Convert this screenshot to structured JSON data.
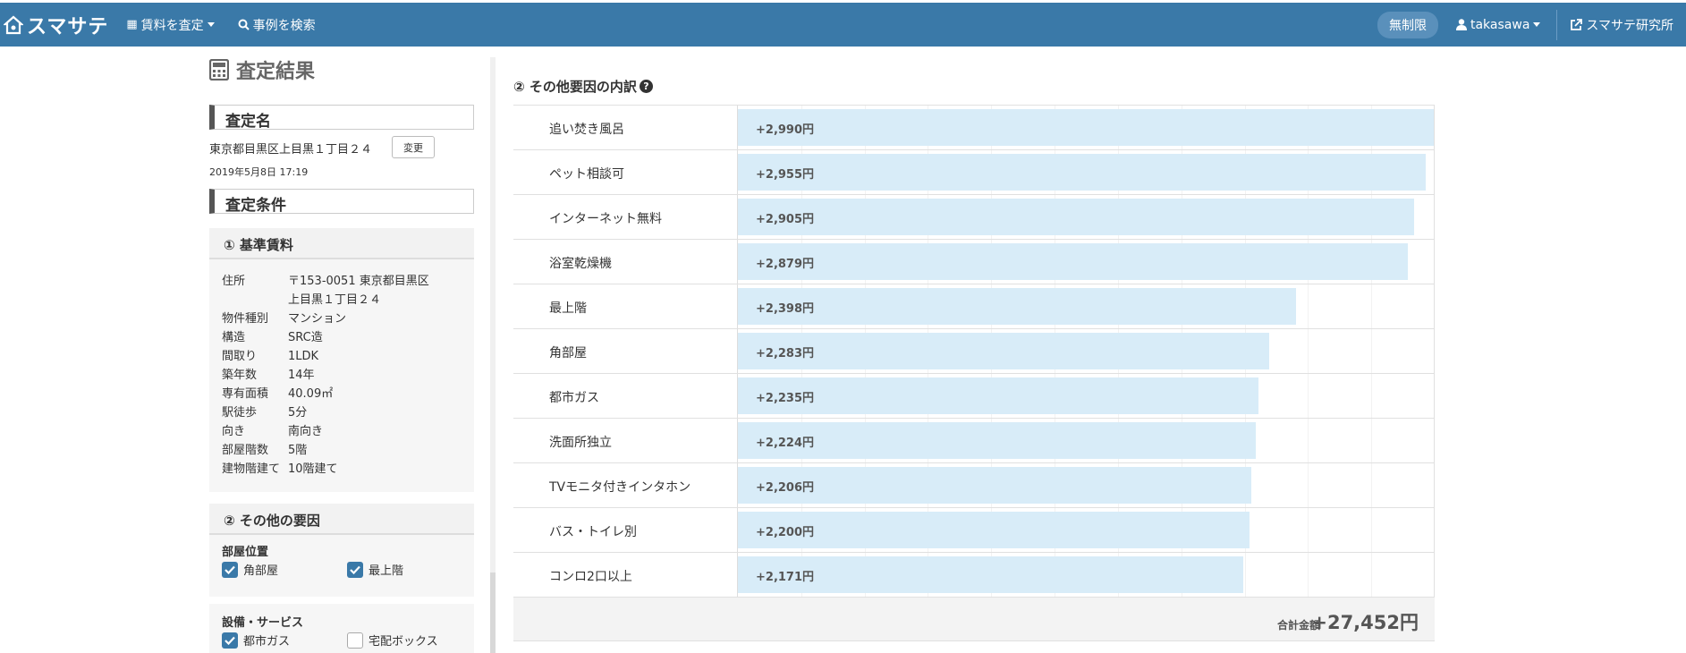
{
  "navbar": {
    "brand": "スマサテ",
    "menu_assess": "賃料を査定",
    "menu_search": "事例を検索",
    "plan_badge": "無制限",
    "user": "takasawa",
    "lab_link": "スマサテ研究所"
  },
  "left": {
    "page_title": "査定結果",
    "name_heading": "査定名",
    "assessment_name": "東京都目黒区上目黒１丁目２４",
    "change_button": "変更",
    "date": "2019年5月8日 17:19",
    "conditions_heading": "査定条件",
    "base_rent": {
      "heading": "① 基準賃料",
      "rows": [
        {
          "key": "住所",
          "value": "〒153-0051 東京都目黒区"
        },
        {
          "key": "",
          "value": "上目黒１丁目２４"
        },
        {
          "key": "物件種別",
          "value": "マンション"
        },
        {
          "key": "構造",
          "value": "SRC造"
        },
        {
          "key": "間取り",
          "value": "1LDK"
        },
        {
          "key": "築年数",
          "value": "14年"
        },
        {
          "key": "専有面積",
          "value": "40.09㎡"
        },
        {
          "key": "駅徒歩",
          "value": "5分"
        },
        {
          "key": "向き",
          "value": "南向き"
        },
        {
          "key": "部屋階数",
          "value": "5階"
        },
        {
          "key": "建物階建て",
          "value": "10階建て"
        }
      ]
    },
    "other_factors": {
      "heading": "② その他の要因",
      "room_position_label": "部屋位置",
      "room_position": [
        {
          "label": "角部屋",
          "checked": true
        },
        {
          "label": "最上階",
          "checked": true
        }
      ],
      "equipment_label": "設備・サービス",
      "equipment": [
        {
          "label": "都市ガス",
          "checked": true
        },
        {
          "label": "宅配ボックス",
          "checked": false
        }
      ]
    }
  },
  "right": {
    "title": "② その他要因の内訳",
    "total_label": "合計金額",
    "total_value": "+27,452円",
    "max_value": 2990
  },
  "chart_data": {
    "type": "bar",
    "orientation": "horizontal",
    "categories": [
      "追い焚き風呂",
      "ペット相談可",
      "インターネット無料",
      "浴室乾燥機",
      "最上階",
      "角部屋",
      "都市ガス",
      "洗面所独立",
      "TVモニタ付きインタホン",
      "バス・トイレ別",
      "コンロ2口以上"
    ],
    "values": [
      2990,
      2955,
      2905,
      2879,
      2398,
      2283,
      2235,
      2224,
      2206,
      2200,
      2171
    ],
    "labels": [
      "+2,990円",
      "+2,955円",
      "+2,905円",
      "+2,879円",
      "+2,398円",
      "+2,283円",
      "+2,235円",
      "+2,224円",
      "+2,206円",
      "+2,200円",
      "+2,171円"
    ],
    "bar_color": "#d8ecf8",
    "xlim": [
      0,
      2990
    ]
  }
}
